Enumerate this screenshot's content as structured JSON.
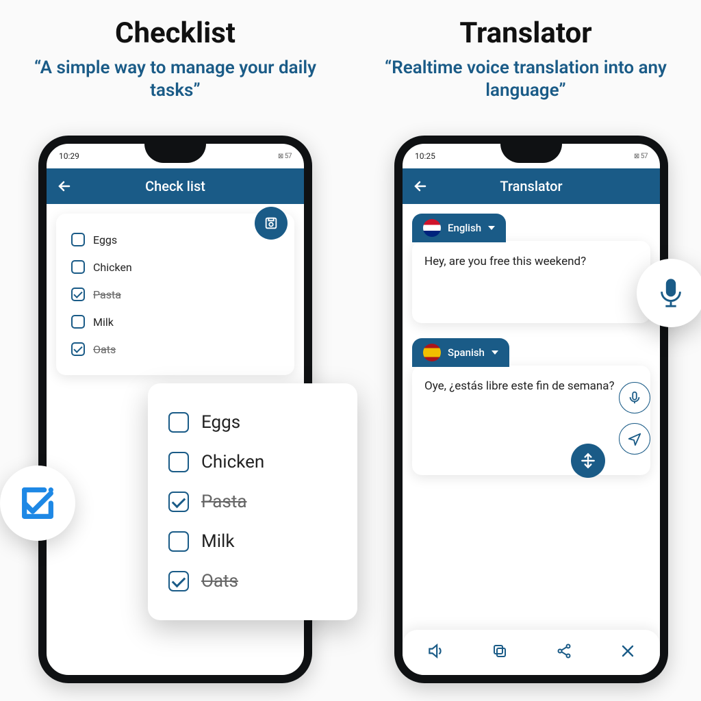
{
  "left": {
    "heading": "Checklist",
    "tagline": "“A simple way to manage your daily tasks”",
    "status_time": "10:29",
    "status_batt": "57",
    "appbar_title": "Check list",
    "items": [
      {
        "label": "Eggs",
        "done": false
      },
      {
        "label": "Chicken",
        "done": false
      },
      {
        "label": "Pasta",
        "done": true
      },
      {
        "label": "Milk",
        "done": false
      },
      {
        "label": "Oats",
        "done": true
      }
    ]
  },
  "right": {
    "heading": "Translator",
    "tagline": "“Realtime voice translation into any language”",
    "status_time": "10:25",
    "status_batt": "57",
    "appbar_title": "Translator",
    "source_lang": "English",
    "source_text": "Hey, are you free this weekend?",
    "target_lang": "Spanish",
    "target_text": "Oye, ¿estás libre este fin de semana?"
  }
}
